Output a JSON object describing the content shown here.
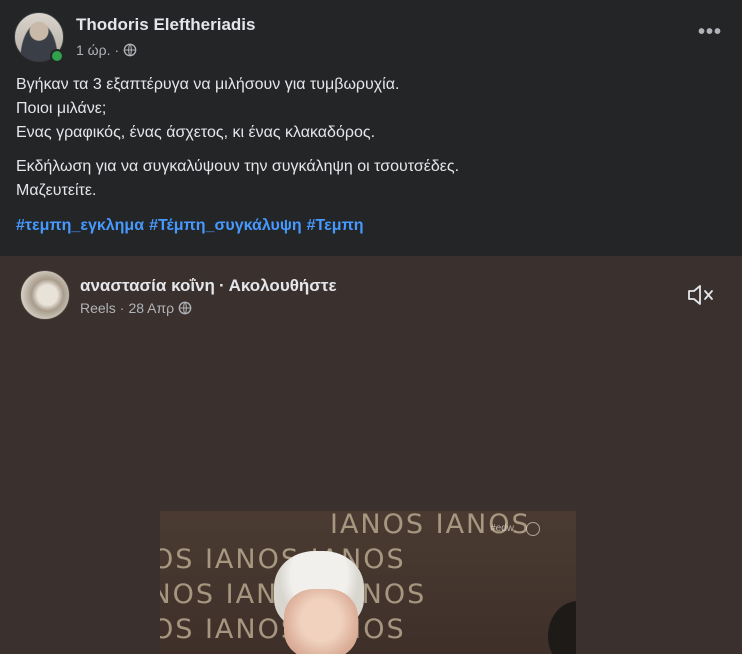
{
  "post": {
    "author": "Thodoris Eleftheriadis",
    "time": "1 ώρ.",
    "separator": "·",
    "more_label": "•••",
    "paragraphs": [
      [
        "Βγήκαν τα 3 εξαπτέρυγα να μιλήσουν για τυμβωρυχία.",
        "Ποιοι μιλάνε;",
        "Ενας γραφικός, ένας άσχετος, κι ένας κλακαδόρος."
      ],
      [
        "Εκδήλωση για να συγκαλύψουν την συγκάληψη οι τσουτσέδες.",
        "Μαζευτείτε."
      ]
    ],
    "hashtags": [
      "#τεμπη_εγκλημα",
      "#Τέμπη_συγκάλυψη",
      "#Τεμπη"
    ]
  },
  "shared": {
    "name": "αναστασία κοΐνη",
    "separator": "·",
    "follow_label": "Ακολουθήστε",
    "type": "Reels",
    "date": "28 Απρ",
    "meta_separator": "·"
  },
  "video": {
    "background_rows": [
      "IANOS IANOS",
      "OS IANOS IANOS",
      "ANOS IANOS IANOS",
      "OS IANOS IANOS"
    ],
    "watermark": "#edw"
  },
  "icons": {
    "privacy": "globe-icon",
    "more": "more-options-icon",
    "mute": "muted-speaker-icon"
  },
  "colors": {
    "background": "#242526",
    "text": "#e4e6eb",
    "secondary_text": "#b0b3b8",
    "hashtag": "#4599ff",
    "online": "#31a24c"
  }
}
